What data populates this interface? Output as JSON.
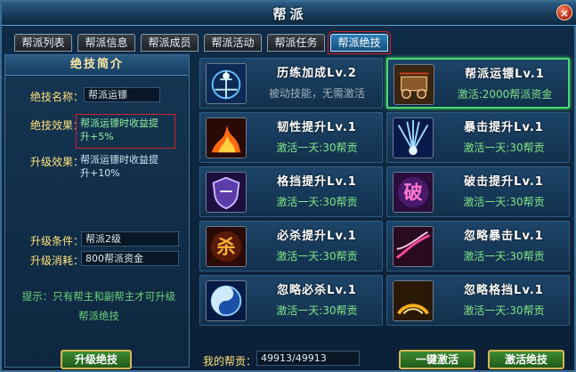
{
  "window": {
    "title": "帮派",
    "close_label": "×"
  },
  "tabs": [
    {
      "label": "帮派列表"
    },
    {
      "label": "帮派信息"
    },
    {
      "label": "帮派成员"
    },
    {
      "label": "帮派活动"
    },
    {
      "label": "帮派任务"
    },
    {
      "label": "帮派绝技"
    }
  ],
  "left": {
    "header": "绝技简介",
    "name_label": "绝技名称：",
    "name_value": "帮派运镖",
    "effect_label": "绝技效果：",
    "effect_line1": "帮派运镖时收益提",
    "effect_line2": "升+5%",
    "upgrade_effect_label": "升级效果：",
    "upgrade_effect_line1": "帮派运镖时收益提",
    "upgrade_effect_line2": "升+10%",
    "condition_label": "升级条件：",
    "condition_value": "帮派2级",
    "cost_label": "升级消耗：",
    "cost_value": "800帮派资金",
    "tip_line1": "提示：只有帮主和副帮主才可升级",
    "tip_line2": "帮派绝技",
    "upgrade_button": "升级绝技"
  },
  "skills": [
    {
      "name": "历练加成Lv.2",
      "desc": "被动技能，无需激活",
      "icon": "training-icon"
    },
    {
      "name": "帮派运镖Lv.1",
      "desc": "激活:2000帮派资金",
      "icon": "escort-cart-icon"
    },
    {
      "name": "韧性提升Lv.1",
      "desc": "激活一天:30帮贡",
      "icon": "fire-icon"
    },
    {
      "name": "暴击提升Lv.1",
      "desc": "激活一天:30帮贡",
      "icon": "burst-icon"
    },
    {
      "name": "格挡提升Lv.1",
      "desc": "激活一天:30帮贡",
      "icon": "shield-icon"
    },
    {
      "name": "破击提升Lv.1",
      "desc": "激活一天:30帮贡",
      "icon": "break-glyph-icon"
    },
    {
      "name": "必杀提升Lv.1",
      "desc": "激活一天:30帮贡",
      "icon": "kill-glyph-icon"
    },
    {
      "name": "忽略暴击Lv.1",
      "desc": "激活一天:30帮贡",
      "icon": "ignore-crit-icon"
    },
    {
      "name": "忽略必杀Lv.1",
      "desc": "激活一天:30帮贡",
      "icon": "yin-yang-icon"
    },
    {
      "name": "忽略格挡Lv.1",
      "desc": "激活一天:30帮贡",
      "icon": "ignore-block-icon"
    }
  ],
  "footer": {
    "contrib_label": "我的帮贡：",
    "contrib_value": "49913/49913",
    "one_click_button": "一键激活",
    "activate_button": "激活绝技"
  },
  "colors": {
    "accent_gold": "#ffe07a",
    "active_green": "#7fe385",
    "selection_green": "#4ad86f",
    "highlight_red": "#d3212a"
  }
}
